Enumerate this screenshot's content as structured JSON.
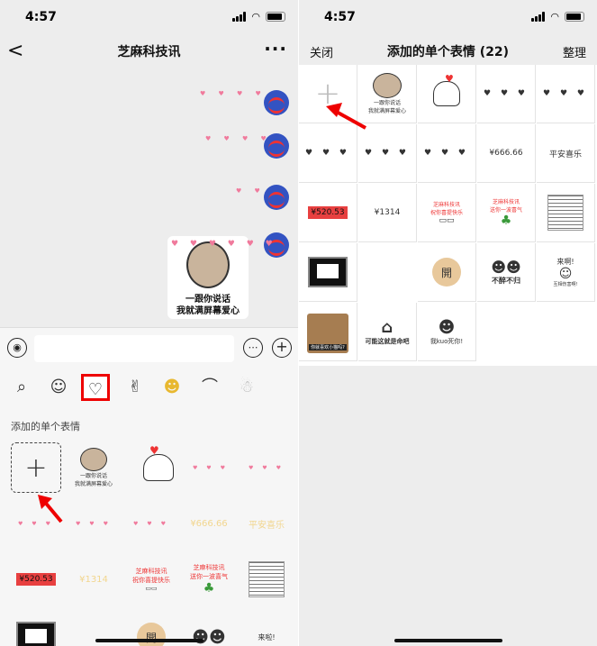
{
  "left": {
    "status": {
      "time": "4:57"
    },
    "nav": {
      "title": "芝麻科技讯",
      "back": "<",
      "more": "···"
    },
    "message_caption": {
      "line1": "一跟你说话",
      "line2": "我就满屏幕爱心"
    },
    "section_label": "添加的单个表情",
    "cells": {
      "price": "¥520.53",
      "gold1": "¥1314",
      "gold2": "¥666.66",
      "gold3": "平安喜乐",
      "kai": "開",
      "laile": "来啦!",
      "sticker_caption_a": "一跟你说话",
      "sticker_caption_b": "我就满屏幕爱心",
      "zhima1": "芝麻科技讯",
      "zhima1_sub": "祝你喜提快乐",
      "zhima2": "芝麻科技讯",
      "zhima2_sub": "送你一波喜气"
    }
  },
  "right": {
    "status": {
      "time": "4:57"
    },
    "nav": {
      "left": "关闭",
      "title": "添加的单个表情 (22)",
      "right": "整理"
    },
    "cells": {
      "add": "+",
      "caption_a": "一跟你说话",
      "caption_b": "我就满屏幕爱心",
      "gold_666": "¥666.66",
      "pingan": "平安喜乐",
      "price": "¥520.53",
      "gold_1314": "¥1314",
      "zhima1": "芝麻科技讯",
      "zhima1_sub": "祝你喜提快乐",
      "zhima2": "芝麻科技讯",
      "zhima2_sub": "送你一波喜气",
      "kai": "開",
      "bujiubugui": "不醉不归",
      "laile": "来啊!",
      "laile_sub": "互相伤害啊!",
      "cat_caption": "你就喜欢小猫吗?",
      "chair_caption": "可能这就是命吧",
      "kuo_caption": "我kuo死你!"
    }
  },
  "colors": {
    "accent_red": "#e00000",
    "price_red": "#e84040",
    "gold": "#f2d68f",
    "heart_pink": "#f07a9c"
  }
}
